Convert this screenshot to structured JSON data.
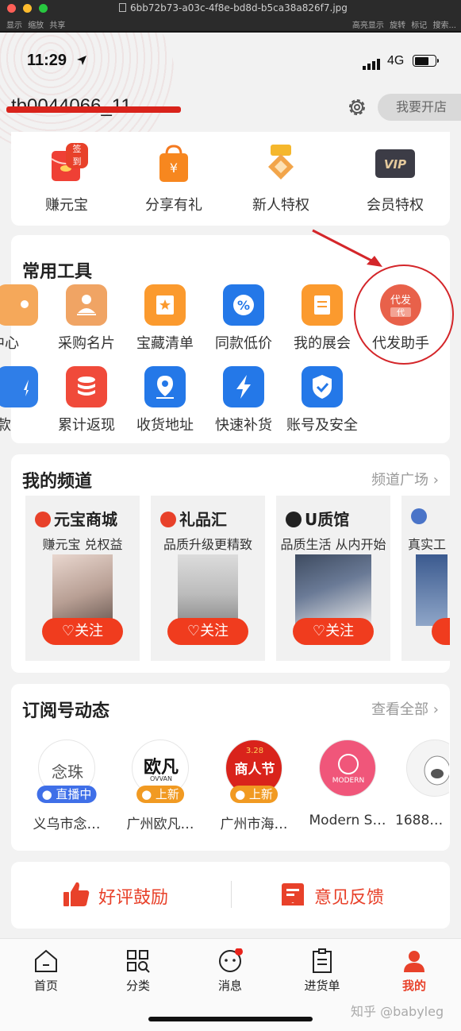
{
  "window": {
    "title": "6bb72b73-a03c-4f8e-bd8d-b5ca38a826f7.jpg",
    "left_tools": [
      "显示",
      "缩放",
      "共享"
    ],
    "right_tools": [
      "高亮显示",
      "旋转",
      "标记",
      "搜索..."
    ]
  },
  "status_bar": {
    "time": "11:29",
    "network": "4G"
  },
  "user": {
    "name": "tb0044066_11",
    "open_shop_label": "我要开店"
  },
  "quick_actions": [
    {
      "label": "赚元宝",
      "badge": "签到",
      "icon": "red-envelope-icon"
    },
    {
      "label": "分享有礼",
      "icon": "gift-bag-icon"
    },
    {
      "label": "新人特权",
      "icon": "medal-icon"
    },
    {
      "label": "会员特权",
      "icon": "vip-card-icon",
      "icon_text": "VIP"
    }
  ],
  "tools": {
    "title": "常用工具",
    "row1": [
      {
        "label": "中心",
        "color": "#f5a85a",
        "icon": "partial-icon"
      },
      {
        "label": "采购名片",
        "color": "#f0a464",
        "icon": "person-card-icon"
      },
      {
        "label": "宝藏清单",
        "color": "#fb9a2e",
        "icon": "star-list-icon"
      },
      {
        "label": "同款低价",
        "color": "#2478e8",
        "icon": "percent-badge-icon",
        "icon_text": "%"
      },
      {
        "label": "我的展会",
        "color": "#fb9a2e",
        "icon": "document-icon"
      },
      {
        "label": "代发助手",
        "color": "#e8614a",
        "icon": "dropship-icon",
        "icon_text": "代发",
        "icon_sub": "代"
      }
    ],
    "row2": [
      {
        "label": "款",
        "color": "#2f7ee8",
        "icon": "partial-icon"
      },
      {
        "label": "累计返现",
        "color": "#f04a3a",
        "icon": "coins-stack-icon"
      },
      {
        "label": "收货地址",
        "color": "#2478e8",
        "icon": "location-pin-icon"
      },
      {
        "label": "快速补货",
        "color": "#2478e8",
        "icon": "lightning-icon"
      },
      {
        "label": "账号及安全",
        "color": "#2478e8",
        "icon": "shield-check-icon"
      }
    ]
  },
  "channels": {
    "title": "我的频道",
    "more_label": "频道广场",
    "items": [
      {
        "name": "元宝商城",
        "logo_color": "#e8412a",
        "logo_text": "元宝商城",
        "subtitle": "赚元宝 兑权益",
        "follow_label": "关注",
        "image_colors": [
          "#d8c2b8",
          "#6b5a53"
        ]
      },
      {
        "name": "礼品汇",
        "logo_color": "#e8412a",
        "logo_text": "礼品汇",
        "subtitle": "品质升级更精致",
        "follow_label": "关注",
        "image_colors": [
          "#c9c9c9",
          "#7b7b7b"
        ]
      },
      {
        "name": "U质馆",
        "logo_color": "#222222",
        "logo_text": "U质馆",
        "subtitle": "品质生活 从内开始",
        "follow_label": "关注",
        "image_colors": [
          "#4b5870",
          "#e8e8e8"
        ]
      },
      {
        "name": "",
        "logo_color": "#4a74c8",
        "logo_text": "",
        "subtitle": "真实工",
        "follow_label": "",
        "image_colors": [
          "#3b5a8f",
          "#8fa6c8"
        ]
      }
    ]
  },
  "subscriptions": {
    "title": "订阅号动态",
    "more_label": "查看全部",
    "items": [
      {
        "name": "义乌市念…",
        "avatar_text": "念珠",
        "tag": "直播中",
        "tag_color": "#3f6fe8"
      },
      {
        "name": "广州欧凡…",
        "avatar_text": "欧凡",
        "avatar_sub": "OVVAN",
        "tag": "上新",
        "tag_color": "#f19a22"
      },
      {
        "name": "广州市海…",
        "avatar_text": "商人节",
        "avatar_sub": "3.28",
        "tag": "上新",
        "tag_color": "#f19a22"
      },
      {
        "name": "Modern S…",
        "avatar_text": "MODERN",
        "tag": "",
        "tag_color": ""
      },
      {
        "name": "1688…",
        "avatar_text": "",
        "tag": "",
        "tag_color": ""
      }
    ]
  },
  "feedback": {
    "praise_label": "好评鼓励",
    "opinion_label": "意见反馈"
  },
  "tabs": [
    {
      "label": "首页",
      "icon": "home-icon",
      "active": false
    },
    {
      "label": "分类",
      "icon": "category-grid-icon",
      "active": false
    },
    {
      "label": "消息",
      "icon": "message-icon",
      "active": false
    },
    {
      "label": "进货单",
      "icon": "order-list-icon",
      "active": false
    },
    {
      "label": "我的",
      "icon": "profile-icon",
      "active": true
    }
  ],
  "watermark": "知乎 @babyleg",
  "colors": {
    "accent": "#e8412a",
    "annotation": "#d4262a"
  }
}
